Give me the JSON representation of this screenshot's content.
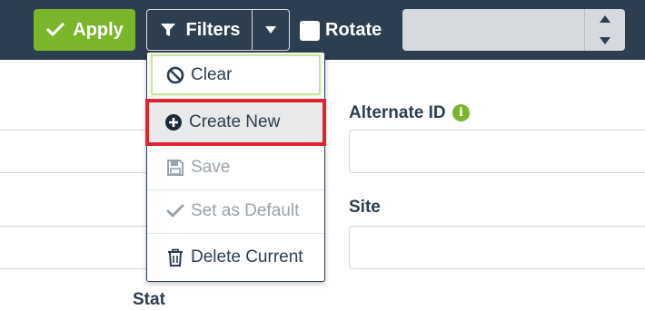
{
  "toolbar": {
    "apply_label": "Apply",
    "filters_label": "Filters",
    "rotate_label": "Rotate",
    "select_value": ""
  },
  "filters_menu": {
    "clear": "Clear",
    "create_new": "Create New",
    "save": "Save",
    "set_default": "Set as Default",
    "delete_current": "Delete Current"
  },
  "form": {
    "alternate_id_label": "Alternate ID",
    "site_label": "Site",
    "partial_label": "Stat"
  },
  "colors": {
    "toolbar_bg": "#2d3e50",
    "accent_green": "#7ab52c",
    "highlight_red": "#e0232e"
  }
}
